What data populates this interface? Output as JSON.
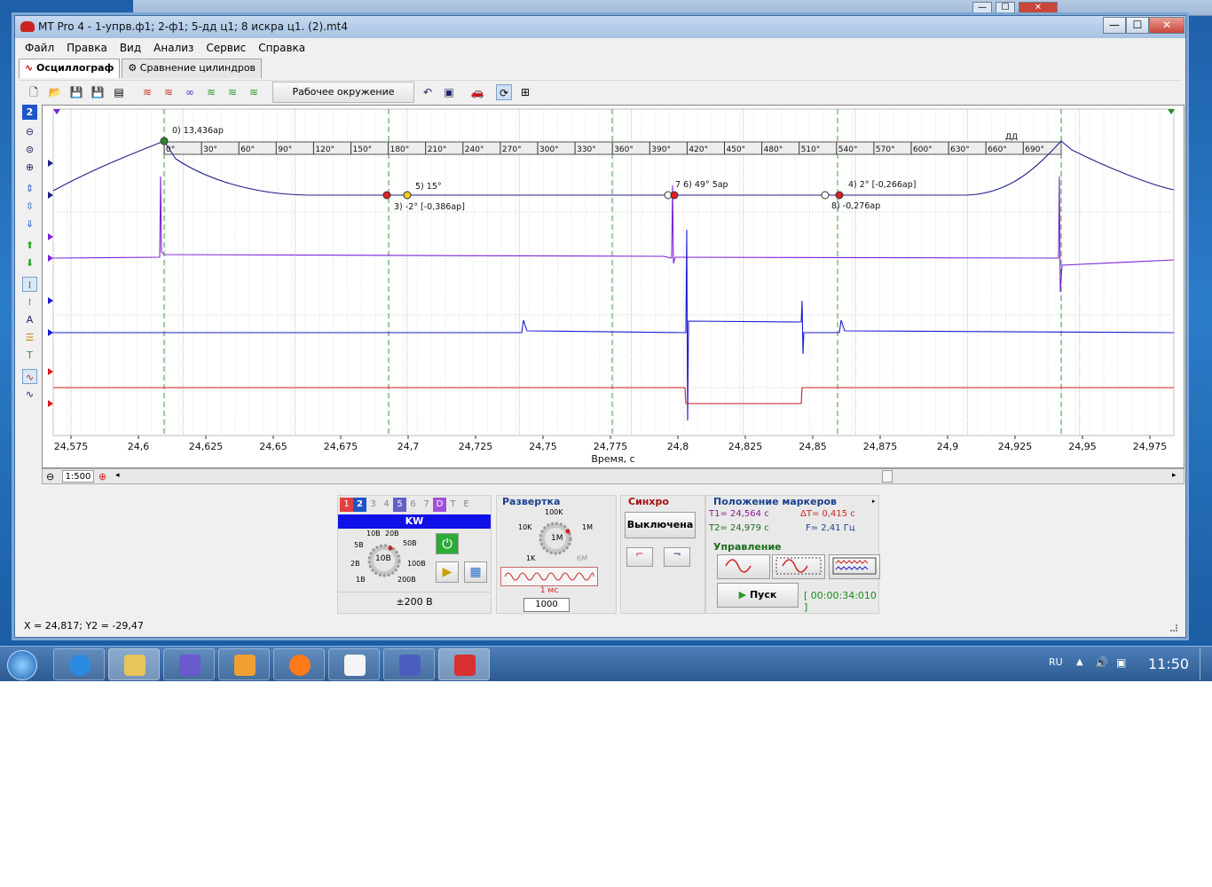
{
  "window": {
    "title": "MT Pro 4 - 1-упрв.ф1; 2-ф1; 5-дд ц1; 8 искра ц1. (2).mt4",
    "min_glyph": "—",
    "max_glyph": "☐",
    "close_glyph": "✕"
  },
  "menu": [
    "Файл",
    "Правка",
    "Вид",
    "Анализ",
    "Сервис",
    "Справка"
  ],
  "tabs": [
    {
      "label": "Осциллограф",
      "active": true
    },
    {
      "label": "Сравнение цилиндров",
      "active": false
    }
  ],
  "toolbar": {
    "work_env_label": "Рабочее окружение"
  },
  "left_panel": {
    "channel_badge": "2"
  },
  "plot": {
    "angle_ticks": [
      "0°",
      "30°",
      "60°",
      "90°",
      "120°",
      "150°",
      "180°",
      "210°",
      "240°",
      "270°",
      "300°",
      "330°",
      "360°",
      "390°",
      "420°",
      "450°",
      "480°",
      "510°",
      "540°",
      "570°",
      "600°",
      "630°",
      "660°",
      "690°"
    ],
    "angle_badge": "ДД",
    "markers": [
      {
        "label": "0)  13,436ар"
      },
      {
        "label": "5)  15°"
      },
      {
        "label": "3)  -2° [-0,386ар]"
      },
      {
        "label": "7 6)  49° 5ар"
      },
      {
        "label": "4)  2° [-0,266ар]"
      },
      {
        "label": "8)  -0,276ар"
      }
    ],
    "x_ticks": [
      "24,575",
      "24,6",
      "24,625",
      "24,65",
      "24,675",
      "24,7",
      "24,725",
      "24,75",
      "24,775",
      "24,8",
      "24,825",
      "24,85",
      "24,875",
      "24,9",
      "24,925",
      "24,95",
      "24,975"
    ],
    "x_label": "Время, с",
    "colors": {
      "purple": "#7a22d6",
      "blue": "#1b1bd0",
      "red": "#d21b1b",
      "navy": "#20208a",
      "green_dash": "#3aa33a"
    }
  },
  "scroll": {
    "scale": "1:500"
  },
  "channels_panel": {
    "tabs": [
      "1",
      "2",
      "3",
      "4",
      "5",
      "6",
      "7",
      "D",
      "T",
      "E"
    ],
    "unit": "KW",
    "dial_labels": [
      "10В",
      "20В",
      "5В",
      "50В",
      "2В",
      "100В",
      "1В",
      "200В"
    ],
    "dial_center": "10В",
    "range": "±200 В"
  },
  "sweep_panel": {
    "title": "Развертка",
    "dial_labels": [
      "100K",
      "10K",
      "1M",
      "1K",
      "6M"
    ],
    "dial_center": "1M",
    "period": "1 мс",
    "points": "1000"
  },
  "sync_panel": {
    "title": "Синхро",
    "mode": "Выключена"
  },
  "markers_panel": {
    "title": "Положение маркеров",
    "t1": "T1= 24,564 c",
    "dt": "ΔT= 0,415 c",
    "t2": "T2= 24,979 c",
    "f": "F= 2,41 Гц"
  },
  "control_panel": {
    "title": "Управление",
    "start": "Пуск",
    "timer": "[ 00:00:34:010 ]"
  },
  "status": "X = 24,817; Y2 = -29,47",
  "taskbar": {
    "lang": "RU",
    "clock": "11:50"
  }
}
